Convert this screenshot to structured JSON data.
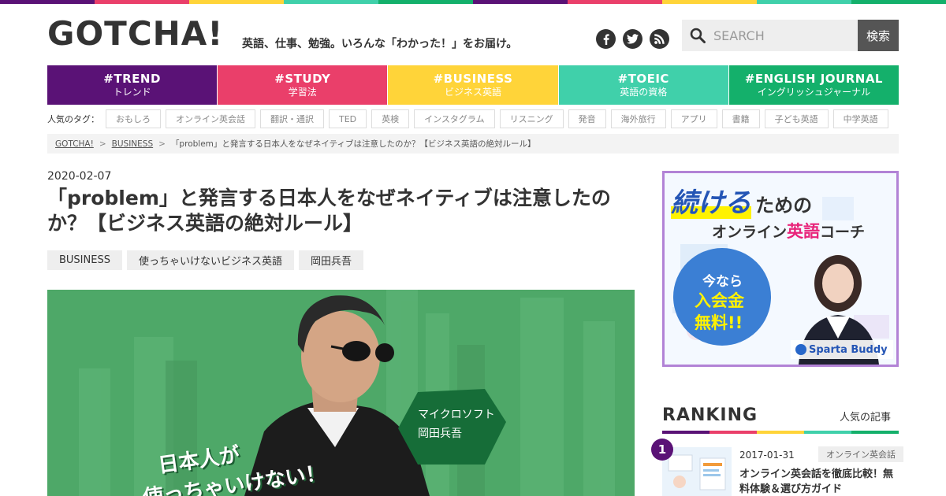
{
  "site": {
    "logo": "GOTCHA!",
    "tagline": "英語、仕事、勉強。いろんな「わかった！」をお届け。",
    "stripe_colors": [
      "#5a1276",
      "#ea3f6a",
      "#ffd439",
      "#40d0aa",
      "#14b06b"
    ]
  },
  "social": [
    {
      "name": "facebook-icon"
    },
    {
      "name": "twitter-icon"
    },
    {
      "name": "rss-icon"
    }
  ],
  "search": {
    "placeholder": "SEARCH",
    "button_label": "検索"
  },
  "nav": [
    {
      "tag": "#TREND",
      "sub": "トレンド",
      "color": "#5a1276"
    },
    {
      "tag": "#STUDY",
      "sub": "学習法",
      "color": "#ea3f6a"
    },
    {
      "tag": "#BUSINESS",
      "sub": "ビジネス英語",
      "color": "#ffd439"
    },
    {
      "tag": "#TOEIC",
      "sub": "英語の資格",
      "color": "#40d0aa"
    },
    {
      "tag": "#ENGLISH JOURNAL",
      "sub": "イングリッシュジャーナル",
      "color": "#14b06b"
    }
  ],
  "tags": {
    "label": "人気のタグ：",
    "items": [
      "おもしろ",
      "オンライン英会話",
      "翻訳・通訳",
      "TED",
      "英検",
      "インスタグラム",
      "リスニング",
      "発音",
      "海外旅行",
      "アプリ",
      "書籍",
      "子ども英語",
      "中学英語"
    ]
  },
  "breadcrumb": {
    "home": "GOTCHA!",
    "category": "BUSINESS",
    "separator": ">",
    "current": "「problem」と発言する日本人をなぜネイティブは注意したのか？【ビジネス英語の絶対ルール】"
  },
  "article": {
    "date": "2020-02-07",
    "title": "「problem」と発言する日本人をなぜネイティブは注意したのか？【ビジネス英語の絶対ルール】",
    "categories": [
      "BUSINESS",
      "使っちゃいけないビジネス英語",
      "岡田兵吾"
    ],
    "hero": {
      "name_line1": "マイクロソフト",
      "name_line2": "岡田兵吾",
      "headline_line1": "日本人が",
      "headline_line2": "使っちゃいけない！",
      "bg_color": "#4ea868"
    }
  },
  "banner": {
    "headline_big": "続ける",
    "headline_rest": "ための",
    "line2_pre": "オンライン",
    "line2_em": "英語",
    "line2_post": "コーチ",
    "circle_line1": "今なら",
    "circle_line2": "入会金",
    "circle_line3": "無料!!",
    "brand": "Sparta Buddy"
  },
  "ranking": {
    "title": "RANKING",
    "subtitle": "人気の記事",
    "items": [
      {
        "rank": "1",
        "date": "2017-01-31",
        "category": "オンライン英会話",
        "title": "オンライン英会話を徹底比較！無料体験＆選び方ガイド"
      }
    ]
  }
}
